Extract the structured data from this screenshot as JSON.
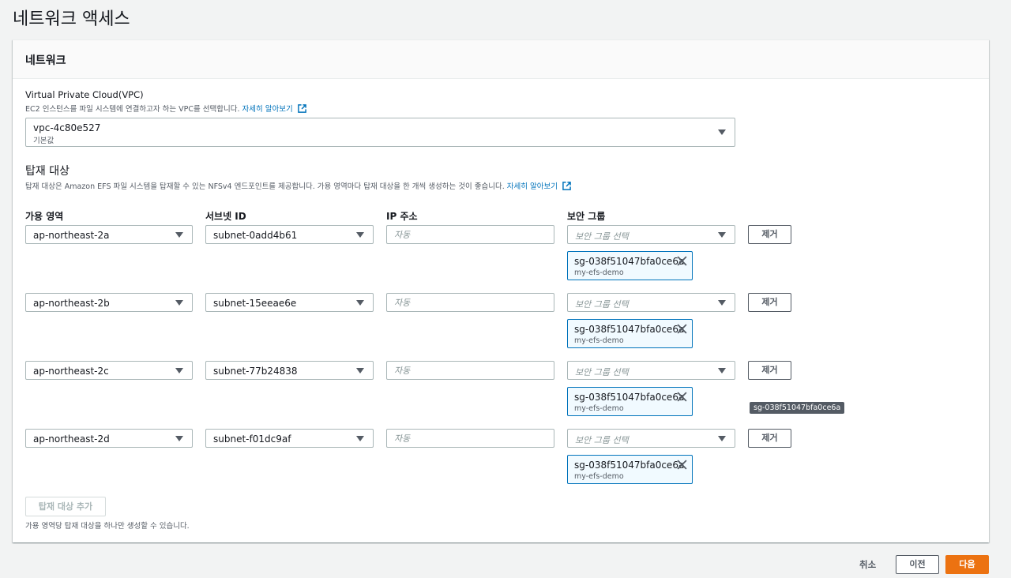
{
  "page": {
    "title": "네트워크 액세스"
  },
  "network": {
    "header": "네트워크",
    "vpc": {
      "label": "Virtual Private Cloud(VPC)",
      "description": "EC2 인스턴스를 파일 시스템에 연결하고자 하는 VPC를 선택합니다.",
      "learn_more": "자세히 알아보기",
      "value": "vpc-4c80e527",
      "sub": "기본값"
    },
    "mount_targets": {
      "title": "탑재 대상",
      "description": "탑재 대상은 Amazon EFS 파일 시스템을 탑재할 수 있는 NFSv4 엔드포인트를 제공합니다. 가용 영역마다 탑재 대상을 한 개씩 생성하는 것이 좋습니다.",
      "learn_more": "자세히 알아보기",
      "columns": {
        "az": "가용 영역",
        "subnet": "서브넷 ID",
        "ip": "IP 주소",
        "sg": "보안 그룹"
      },
      "ip_placeholder": "자동",
      "sg_placeholder": "보안 그룹 선택",
      "remove_label": "제거",
      "rows": [
        {
          "az": "ap-northeast-2a",
          "subnet": "subnet-0add4b61",
          "sg_id": "sg-038f51047bfa0ce6a",
          "sg_name": "my-efs-demo"
        },
        {
          "az": "ap-northeast-2b",
          "subnet": "subnet-15eeae6e",
          "sg_id": "sg-038f51047bfa0ce6a",
          "sg_name": "my-efs-demo"
        },
        {
          "az": "ap-northeast-2c",
          "subnet": "subnet-77b24838",
          "sg_id": "sg-038f51047bfa0ce6a",
          "sg_name": "my-efs-demo"
        },
        {
          "az": "ap-northeast-2d",
          "subnet": "subnet-f01dc9af",
          "sg_id": "sg-038f51047bfa0ce6a",
          "sg_name": "my-efs-demo"
        }
      ],
      "add_label": "탑재 대상 추가",
      "footnote": "가용 영역당 탑재 대상을 하나만 생성할 수 있습니다."
    },
    "tooltip": "sg-038f51047bfa0ce6a"
  },
  "footer": {
    "cancel": "취소",
    "previous": "이전",
    "next": "다음"
  },
  "colors": {
    "accent": "#ec7211",
    "link": "#0073bb",
    "token_bg": "#f1faff"
  }
}
